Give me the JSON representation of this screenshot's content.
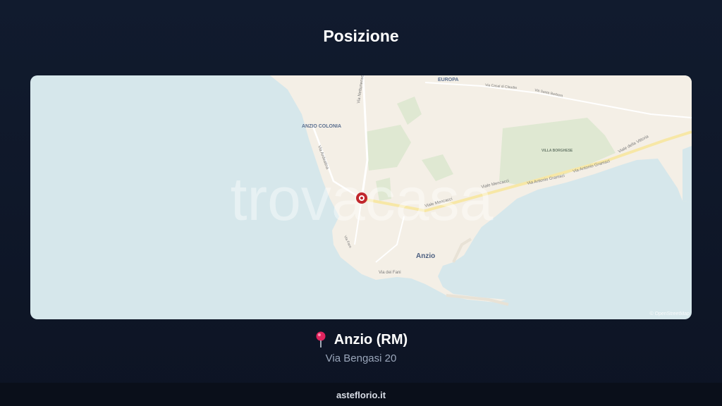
{
  "page": {
    "title": "Posizione"
  },
  "map": {
    "watermark": "trovacasa",
    "attribution": "© OpenStreetMap",
    "labels": {
      "europa": "EUROPA",
      "anzio_colonia": "ANZIO COLONIA",
      "villa_borghese": "VILLA BORGHESE",
      "anzio": "Anzio",
      "via_nettunense": "Via Nettunense",
      "via_ardeatina": "Via Ardeatina",
      "viale_mencacci_1": "Viale Mencacci",
      "viale_mencacci_2": "Viale Mencacci",
      "via_antonio_gramsci_1": "Via Antonio Gramsci",
      "via_antonio_gramsci_2": "Via Antonio Gramsci",
      "viale_della_vittoria": "Viale della Vittoria",
      "via_dei_fani": "Via dei Fani",
      "via_casal_di_claudia": "Via Casal di Claudia",
      "via_santa_barbara": "Via Santa Barbara",
      "via_faro": "Via Faro"
    },
    "colors": {
      "sea": "#d6e7eb",
      "land": "#f4efe6",
      "park": "#dfe8d2",
      "marker": "#c1272d"
    }
  },
  "location": {
    "pin_icon": "map-pin-icon",
    "city": "Anzio (RM)",
    "street": "Via Bengasi 20"
  },
  "footer": {
    "site": "asteflorio.it"
  }
}
